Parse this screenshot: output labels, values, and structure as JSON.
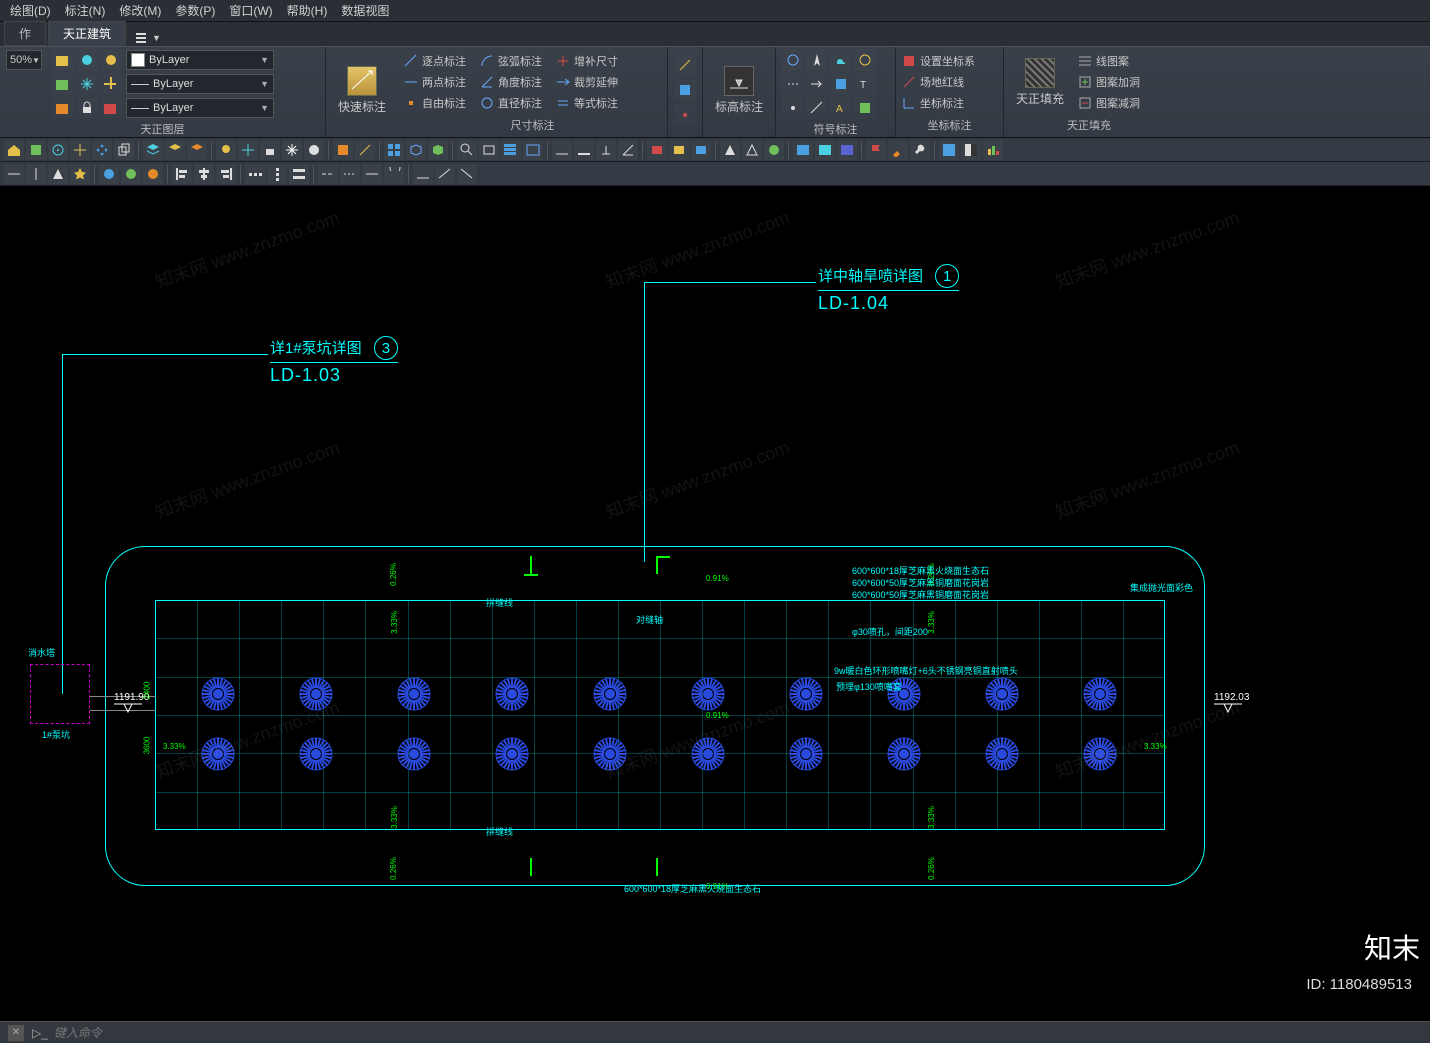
{
  "menubar": [
    "绘图(D)",
    "标注(N)",
    "修改(M)",
    "参数(P)",
    "窗口(W)",
    "帮助(H)",
    "数据视图"
  ],
  "tabs": {
    "left": "作",
    "active": "天正建筑",
    "extra_icon": "caret"
  },
  "zoom_pct": "50%",
  "layer_combo": [
    "ByLayer",
    "ByLayer",
    "ByLayer"
  ],
  "panels": {
    "layer": "天正图层",
    "quick_dim": {
      "label": "快速标注",
      "col1": [
        "逐点标注",
        "两点标注",
        "自由标注"
      ],
      "col2": [
        "弦弧标注",
        "角度标注",
        "直径标注"
      ],
      "col3": [
        "增补尺寸",
        "裁剪延伸",
        "等式标注"
      ]
    },
    "dim": "尺寸标注",
    "elev": "标高标注",
    "sym": "符号标注",
    "coord": {
      "title": "坐标标注",
      "items": [
        "设置坐标系",
        "场地红线",
        "坐标标注"
      ]
    },
    "fill": {
      "title": "天正填充",
      "items": [
        "线图案",
        "图案加洞",
        "图案减洞"
      ],
      "big": "天正填充"
    }
  },
  "callout1": {
    "text": "详1#泵坑详图",
    "num": "3",
    "ref": "LD-1.03"
  },
  "callout2": {
    "text": "详中轴旱喷详图",
    "num": "1",
    "ref": "LD-1.04"
  },
  "elev_left": "1191.90",
  "elev_right": "1192.03",
  "pump_pit_label": "消水塔",
  "pump_pit_sub": "1#泵坑",
  "dims": {
    "v1": "2400",
    "v2": "3600",
    "p1": "3.33%",
    "p2": "0.26%",
    "p3": "0.91%"
  },
  "notes": {
    "n1": "600*600*18厚芝麻黑火烧面生态石",
    "n2": "600*600*50厚芝麻黑铜磨面花岗岩",
    "n3": "600*600*50厚芝麻黑铜磨面花岗岩",
    "n4": "φ30喷孔，间距200",
    "n5": "9w暖白色环形喷嘴灯+6头不锈钢亮铜直射喷头",
    "n6": "集成抛光面彩色",
    "n7": "600*600*18厚芝麻黑火烧面生态石",
    "n8": "预埋φ130喷嘴套",
    "n9": "对缝轴",
    "n10": "拼缝线"
  },
  "cmdline_placeholder": "键入命令",
  "watermark_text": "知末网 www.znzmo.com",
  "brand": "知末",
  "asset_id": "ID: 1180489513"
}
